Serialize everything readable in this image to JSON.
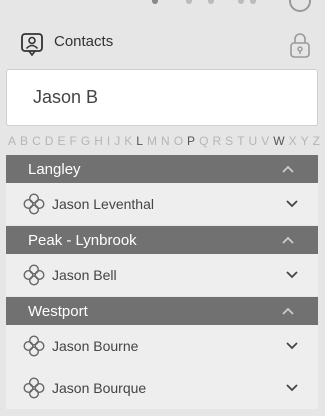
{
  "header": {
    "title": "Contacts"
  },
  "search": {
    "value": "Jason B"
  },
  "alphabet": [
    "A",
    "B",
    "C",
    "D",
    "E",
    "F",
    "G",
    "H",
    "I",
    "J",
    "K",
    "L",
    "M",
    "N",
    "O",
    "P",
    "Q",
    "R",
    "S",
    "T",
    "U",
    "V",
    "W",
    "X",
    "Y",
    "Z"
  ],
  "alphabet_active": [
    "L",
    "P",
    "W"
  ],
  "groups": [
    {
      "name": "Langley",
      "contacts": [
        {
          "name": "Jason Leventhal"
        }
      ]
    },
    {
      "name": "Peak - Lynbrook",
      "contacts": [
        {
          "name": "Jason Bell"
        }
      ]
    },
    {
      "name": "Westport",
      "contacts": [
        {
          "name": "Jason Bourne"
        },
        {
          "name": "Jason Bourque"
        }
      ]
    }
  ],
  "icons": {
    "header": "contacts-icon",
    "lock": "lock-icon",
    "group_toggle": "chevron-up-icon",
    "contact_icon": "clover-icon",
    "contact_expand": "chevron-down-icon"
  },
  "colors": {
    "background": "#e6e6e6",
    "group_header": "#717171",
    "item_background": "#eeeeee",
    "alpha_inactive": "#b5b5b5",
    "alpha_active": "#555555"
  }
}
